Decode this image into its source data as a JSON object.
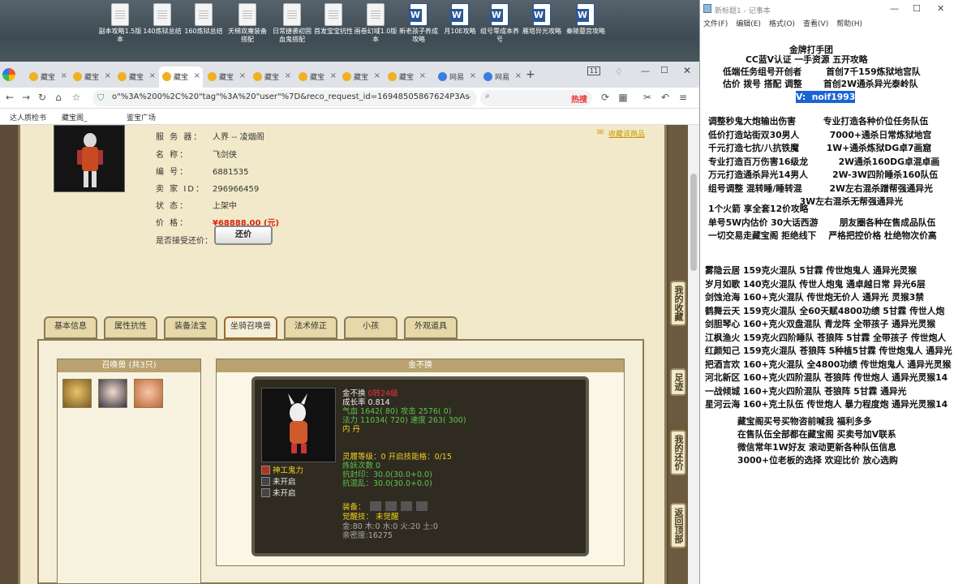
{
  "desktop": {
    "icons": [
      {
        "label": "副本攻略1.5版本",
        "kind": "doc"
      },
      {
        "label": "140炼狱总结",
        "kind": "doc"
      },
      {
        "label": "160炼狱总结",
        "kind": "doc"
      },
      {
        "label": "天梯双魔装备搭配",
        "kind": "doc"
      },
      {
        "label": "日常捷袭初固血鬼搭配",
        "kind": "doc"
      },
      {
        "label": "首发宝宝抗性",
        "kind": "doc"
      },
      {
        "label": "画卷幻域1.0版本",
        "kind": "doc"
      },
      {
        "label": "新老孩子养成攻略",
        "kind": "word"
      },
      {
        "label": "月10E攻略",
        "kind": "word"
      },
      {
        "label": "组号零成本养号",
        "kind": "word"
      },
      {
        "label": "雁塔异光攻略",
        "kind": "word"
      },
      {
        "label": "秦陵墓宫攻略",
        "kind": "word"
      }
    ]
  },
  "browser": {
    "tabs": [
      "藏宝",
      "藏宝",
      "藏宝",
      "藏宝",
      "藏宝",
      "藏宝",
      "藏宝",
      "藏宝",
      "藏宝",
      "网易",
      "网易"
    ],
    "tab_count": "11",
    "url": "o\"%3A%200%2C%20\"tag\"%3A%20\"user\"%7D&reco_request_id=16948505867624P3As",
    "search_hint": "热搜",
    "bookmarks": [
      "达人质检书",
      "藏宝阁_",
      "鉴宝广场"
    ]
  },
  "item": {
    "server_label": "服 务 器：",
    "server": "人界 -- 凌烟阁",
    "name_label": "名 称：",
    "name": "飞剑侠",
    "id_label": "编 号：",
    "id": "6881535",
    "seller_label": "卖 家 ID：",
    "seller": "296966459",
    "status_label": "状 态：",
    "status": "上架中",
    "price_label": "价 格：",
    "price": "¥68888.00 (元)",
    "bargain_label": "是否接受还价：",
    "bargain_button": "还价",
    "favorite": "收藏该商品"
  },
  "tabs": [
    "基本信息",
    "属性抗性",
    "装备法宝",
    "坐骑召唤兽",
    "法术修正",
    "小孩",
    "外观道具"
  ],
  "summons": {
    "header": "召唤兽 (共3只)",
    "pets": [
      "pet-1",
      "pet-2",
      "pet-3"
    ]
  },
  "detail": {
    "header": "金不换",
    "name": "金不换",
    "rebirth": "0转24级",
    "growth": "成长率 0.814",
    "hp": "气血 1642( 80) 攻击 2576( 0)",
    "mp": "法力 11034( 720) 速度 263( 300)",
    "element": "内 丹",
    "spirit": "灵履等级：0 开启技能格：0/15",
    "refine": "炼妖次数 0",
    "seal_res": "抗封印：30.0(30.0+0.0)",
    "chaos_res": "抗混乱：30.0(30.0+0.0)",
    "skills": [
      "神工鬼力",
      "未开启",
      "未开启"
    ],
    "equip_label": "装备：",
    "awaken": "觉醒技：  未觉醒",
    "elements": "金:80 木:0 水:0 火:20 土:0",
    "intimacy": "亲密度:16275"
  },
  "side_nav": [
    "我的收藏",
    "足迹",
    "我的还价",
    "返回顶部"
  ],
  "notepad": {
    "title": "新标题1 - 记事本",
    "menu": [
      "文件(F)",
      "编辑(E)",
      "格式(O)",
      "查看(V)",
      "帮助(H)"
    ],
    "lines_top": [
      "金牌打手团",
      "CC蓝V认证 一手资源 五开攻略",
      "低端任务组号开创者        首创7千159炼狱地宫队",
      "估价 拨号 搭配 调整       首创2W通杀异光泰岭队"
    ],
    "vx": "V:  noif1993",
    "lines_mid": [
      "调整秒鬼大炮输出伤害         专业打造各种价位任务队伍",
      "低价打造站街双30男人          7000+通杀日常炼狱地宫",
      "千元打造七抗/八抗铁魔         1W+通杀炼狱DG卓7画窟",
      "专业打造百万伤害16级龙          2W通杀160DG卓混卓画",
      "万元打造通杀异光14男人        2W-3W四阶睡杀160队伍",
      "组号调整 混转睡/睡转混         2W左右混杀蹭帮强通异光",
      "                              3W左右混杀无帮强通异光",
      "1个火箭 享全套12价攻略",
      "单号5W内估价 30大话西游       朋友圈各种在售成品队伍",
      "一切交易走藏宝阁 拒绝线下    严格把控价格 杜绝物次价高"
    ],
    "lines_list": [
      "雾隐云居 159克火混队 5甘霖 传世炮鬼人 通异光灵猴",
      "岁月如歌 140克火混队 传世人炮鬼 通卓越日常 异光6层",
      "剑蚀沧海 160+克火混队 传世炮无价人 通异光 灵猴3禁",
      "鹤舞云天 159克火混队 全60天赋4800功绩 5甘霖 传世人炮",
      "剑胆琴心 160+克火双盘混队 青龙阵 全带孩子 通异光灵猴",
      "江枫渔火 159克火四阶睡队 苍狼阵 5甘霖 全带孩子 传世炮人",
      "红颜知己 159克火混队 苍狼阵 5种植5甘霖 传世炮鬼人 通异光",
      "把酒言欢 160+克火混队 全4800功绩 传世炮鬼人 通异光灵猴",
      "河北新区 160+克火四阶混队 苍狼阵 传世炮人 通异光灵猴14",
      "一战倾城 160+克火四阶混队 苍狼阵 5甘霖 通异光",
      "星河云海 160+克土队伍 传世炮人 暴力程度炮 通异光灵猴14"
    ],
    "lines_bottom": [
      "藏宝阁买号买物咨前喊我 福利多多",
      "在售队伍全部都在藏宝阁 买卖号加V联系",
      "微信常年1W好友 滚动更新各种队伍信息",
      "3000+位老板的选择 欢迎比价 放心选购"
    ]
  }
}
